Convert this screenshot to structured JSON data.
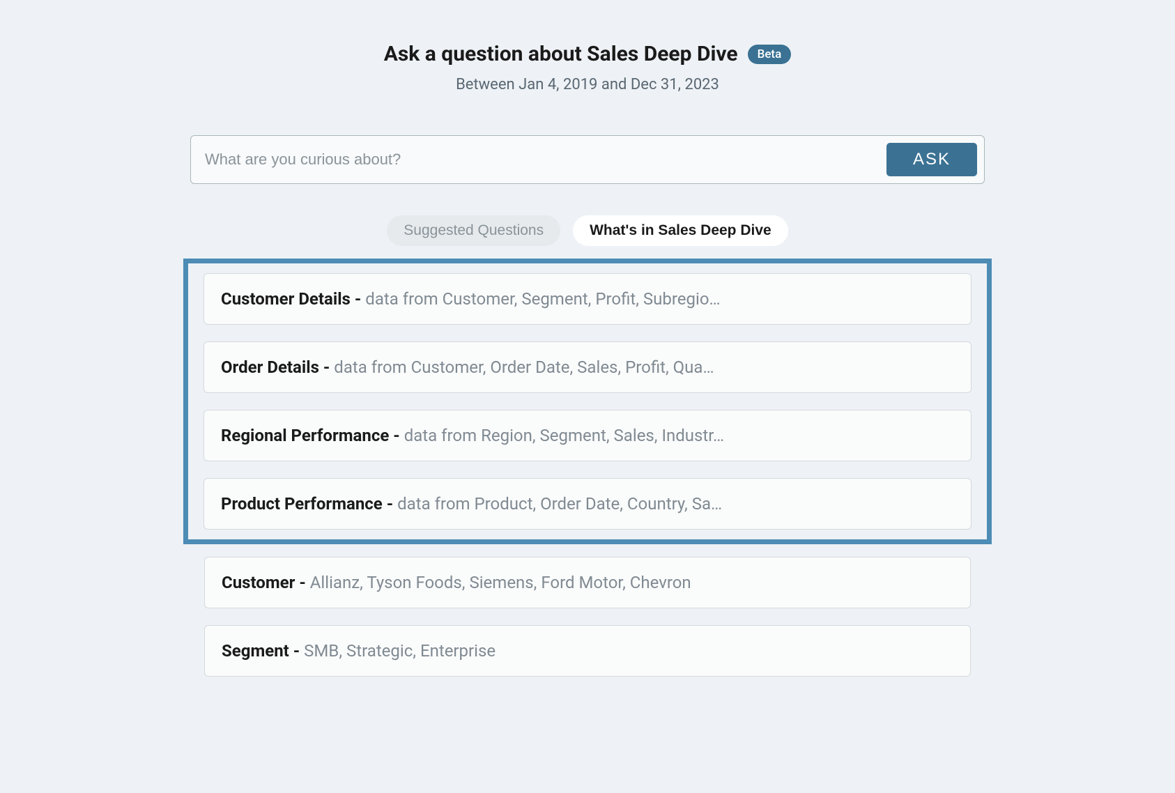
{
  "header": {
    "title": "Ask a question about Sales Deep Dive",
    "badge": "Beta",
    "date_range": "Between Jan 4, 2019 and Dec 31, 2023"
  },
  "search": {
    "placeholder": "What are you curious about?",
    "button_label": "ASK"
  },
  "tabs": {
    "suggested": "Suggested Questions",
    "whatsin": "What's in Sales Deep Dive"
  },
  "highlighted_cards": [
    {
      "title": "Customer Details - ",
      "desc": "data from Customer, Segment, Profit, Subregio…"
    },
    {
      "title": "Order Details - ",
      "desc": "data from Customer, Order Date, Sales, Profit, Qua…"
    },
    {
      "title": "Regional Performance - ",
      "desc": "data from Region, Segment, Sales, Industr…"
    },
    {
      "title": "Product Performance - ",
      "desc": "data from Product, Order Date, Country, Sa…"
    }
  ],
  "other_cards": [
    {
      "title": "Customer - ",
      "desc": "Allianz, Tyson Foods, Siemens, Ford Motor, Chevron"
    },
    {
      "title": "Segment - ",
      "desc": "SMB, Strategic, Enterprise"
    }
  ]
}
